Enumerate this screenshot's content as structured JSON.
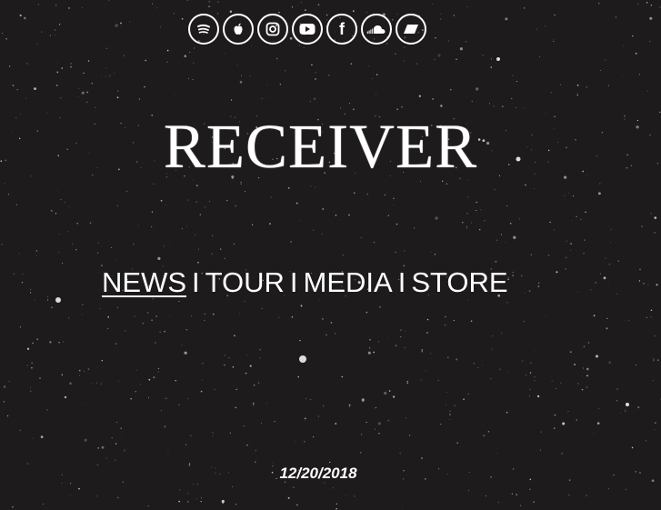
{
  "social": {
    "icons": [
      {
        "name": "spotify-icon"
      },
      {
        "name": "apple-music-icon"
      },
      {
        "name": "instagram-icon"
      },
      {
        "name": "youtube-icon"
      },
      {
        "name": "facebook-icon",
        "glyph": "f"
      },
      {
        "name": "soundcloud-icon"
      },
      {
        "name": "bandcamp-icon"
      }
    ]
  },
  "header": {
    "title": "RECEIVER"
  },
  "nav": {
    "items": [
      {
        "label": "NEWS",
        "active": true
      },
      {
        "label": "TOUR"
      },
      {
        "label": "MEDIA"
      },
      {
        "label": "STORE"
      }
    ],
    "separator": "I"
  },
  "post": {
    "date": "12/20/2018"
  }
}
